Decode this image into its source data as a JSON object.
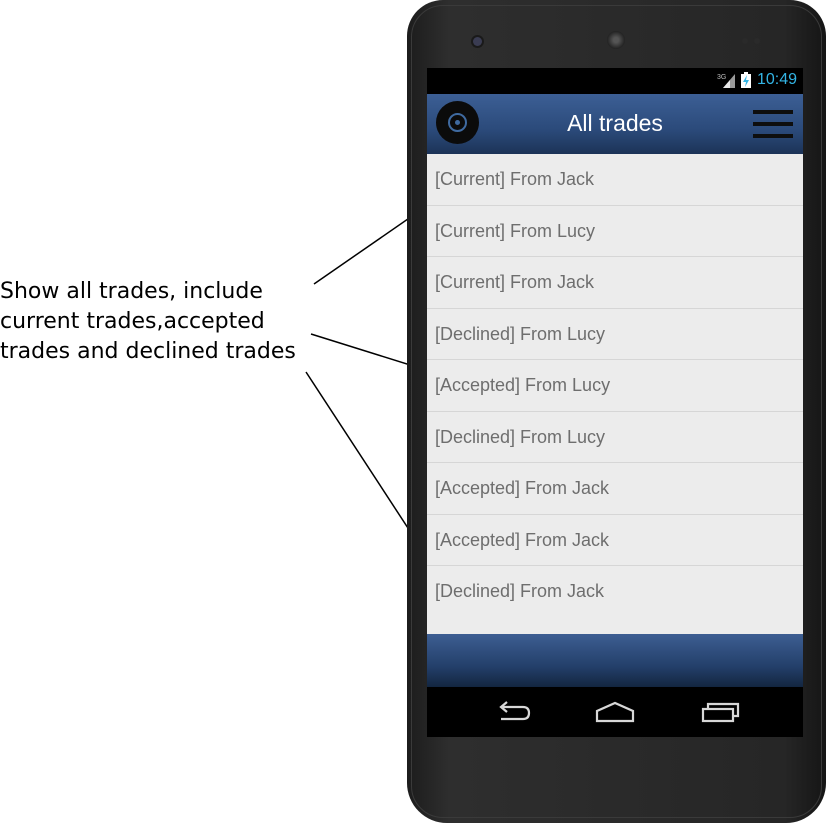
{
  "annotation": {
    "text": "Show all trades, include\ncurrent trades,accepted\ntrades and declined trades"
  },
  "status_bar": {
    "network": "3G",
    "time": "10:49",
    "accent_color": "#33b5e5"
  },
  "app_bar": {
    "title": "All trades",
    "logo_icon": "vinyl-record-icon",
    "menu_icon": "hamburger-menu-icon"
  },
  "trades": [
    {
      "label": "[Current] From Jack"
    },
    {
      "label": "[Current] From Lucy"
    },
    {
      "label": "[Current] From Jack"
    },
    {
      "label": "[Declined] From Lucy"
    },
    {
      "label": "[Accepted] From Lucy"
    },
    {
      "label": "[Declined] From Lucy"
    },
    {
      "label": "[Accepted] From Jack"
    },
    {
      "label": "[Accepted] From Jack"
    },
    {
      "label": "[Declined] From Jack"
    }
  ],
  "nav_bar": {
    "buttons": [
      "back-icon",
      "home-icon",
      "recent-apps-icon"
    ]
  }
}
